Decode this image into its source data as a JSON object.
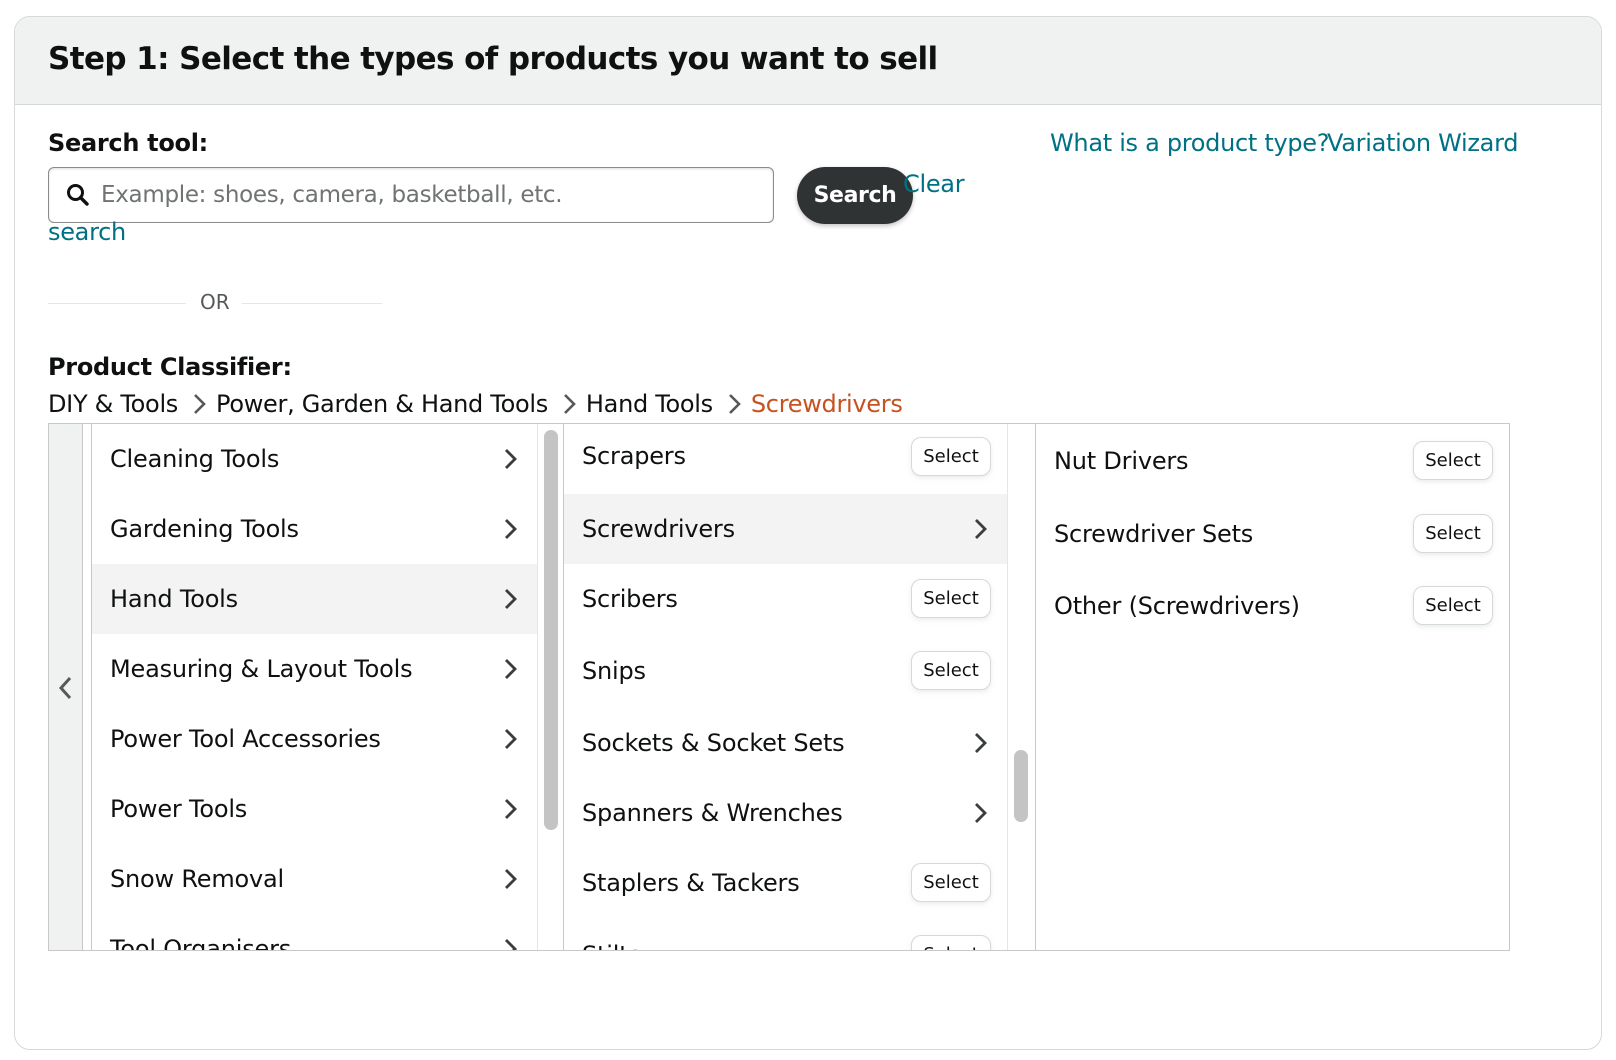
{
  "header": {
    "title": "Step 1: Select the types of products you want to sell"
  },
  "search": {
    "label": "Search tool:",
    "placeholder": "Example: shoes, camera, basketball, etc.",
    "value": "",
    "button_label": "Search",
    "clear_label_line1": "Clear",
    "clear_label_line2": "search",
    "icon": "search-icon"
  },
  "help_links": {
    "product_type": "What is a product type?",
    "variation_wizard": "Variation Wizard"
  },
  "divider": {
    "text": "OR"
  },
  "classifier": {
    "label": "Product Classifier:",
    "breadcrumb": [
      {
        "label": "DIY & Tools",
        "current": false
      },
      {
        "label": "Power, Garden & Hand Tools",
        "current": false
      },
      {
        "label": "Hand Tools",
        "current": false
      },
      {
        "label": "Screwdrivers",
        "current": true
      }
    ],
    "back_icon": "chevron-left-icon",
    "select_label": "Select",
    "columns": [
      {
        "items": [
          {
            "label": "Cleaning Tools",
            "type": "category",
            "active": false
          },
          {
            "label": "Gardening Tools",
            "type": "category",
            "active": false
          },
          {
            "label": "Hand Tools",
            "type": "category",
            "active": true
          },
          {
            "label": "Measuring & Layout Tools",
            "type": "category",
            "active": false
          },
          {
            "label": "Power Tool Accessories",
            "type": "category",
            "active": false
          },
          {
            "label": "Power Tools",
            "type": "category",
            "active": false
          },
          {
            "label": "Snow Removal",
            "type": "category",
            "active": false
          },
          {
            "label": "Tool Organisers",
            "type": "category",
            "active": false
          }
        ]
      },
      {
        "items": [
          {
            "label": "Scrapers",
            "type": "leaf",
            "active": false
          },
          {
            "label": "Screwdrivers",
            "type": "category",
            "active": true
          },
          {
            "label": "Scribers",
            "type": "leaf",
            "active": false
          },
          {
            "label": "Snips",
            "type": "leaf",
            "active": false
          },
          {
            "label": "Sockets & Socket Sets",
            "type": "category",
            "active": false
          },
          {
            "label": "Spanners & Wrenches",
            "type": "category",
            "active": false
          },
          {
            "label": "Staplers & Tackers",
            "type": "leaf",
            "active": false
          },
          {
            "label": "Stilts",
            "type": "leaf",
            "active": false
          }
        ]
      },
      {
        "items": [
          {
            "label": "Nut Drivers",
            "type": "leaf",
            "active": false
          },
          {
            "label": "Screwdriver Sets",
            "type": "leaf",
            "active": false
          },
          {
            "label": "Other (Screwdrivers)",
            "type": "leaf",
            "active": false
          }
        ]
      }
    ]
  },
  "colors": {
    "link": "#007185",
    "current_crumb": "#c7511f",
    "search_button": "#2f3333",
    "header_bg": "#f0f2f2",
    "active_row": "#f3f3f3"
  }
}
